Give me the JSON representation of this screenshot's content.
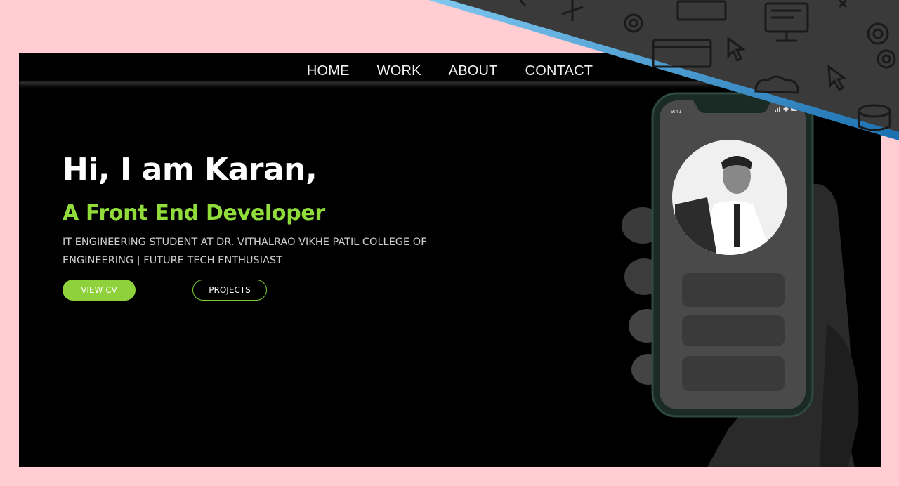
{
  "nav": {
    "items": [
      {
        "label": "HOME"
      },
      {
        "label": "WORK"
      },
      {
        "label": "ABOUT"
      },
      {
        "label": "CONTACT"
      }
    ]
  },
  "hero": {
    "greeting": "Hi, I am Karan,",
    "role": "A Front End Developer",
    "bio": "IT ENGINEERING STUDENT AT DR. VITHALRAO VIKHE PATIL COLLEGE OF ENGINEERING | FUTURE TECH ENTHUSIAST",
    "cv_button": "VIEW CV",
    "projects_button": "PROJECTS"
  },
  "phone": {
    "time": "9:41",
    "icons": [
      "signal-icon",
      "wifi-icon",
      "battery-icon"
    ]
  },
  "colors": {
    "page_bg": "#ffcdd2",
    "panel_bg": "#000000",
    "accent": "#8fd13a",
    "deco_band": "#3a3a3a",
    "deco_edge": "#2aa0e0"
  },
  "decoration_icons": [
    "gear-icon",
    "cursor-icon",
    "monitor-icon",
    "browser-window-icon",
    "cloud-icon",
    "database-icon",
    "plus-icon"
  ]
}
